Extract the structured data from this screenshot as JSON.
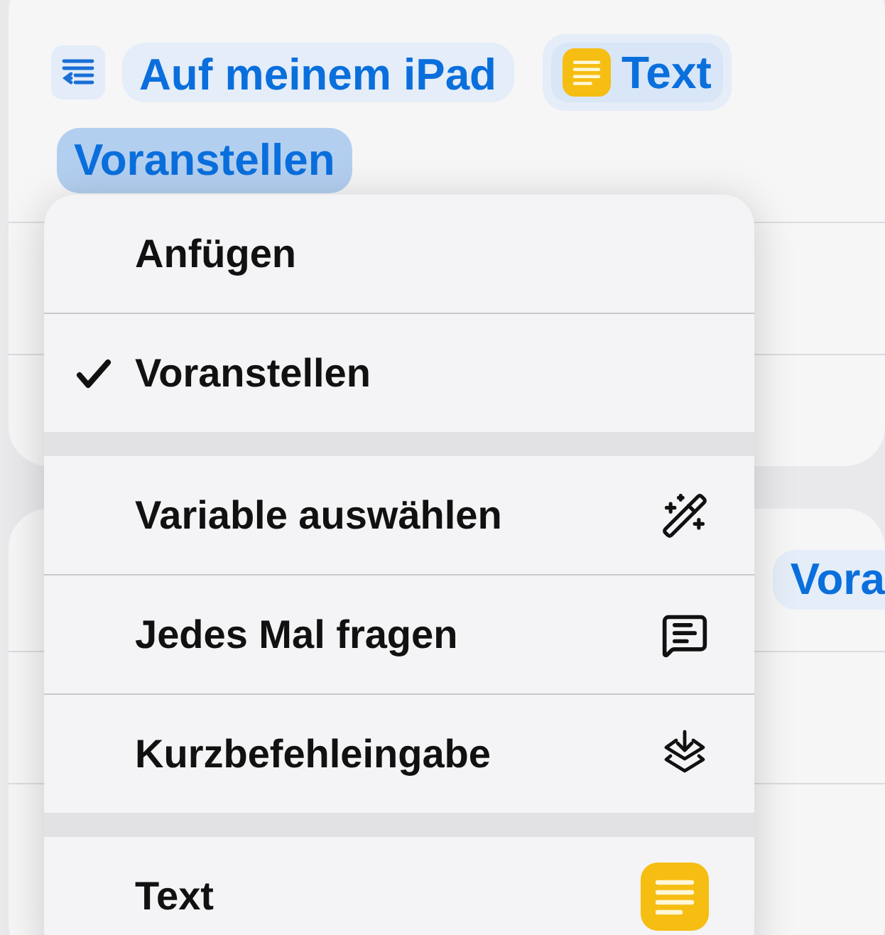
{
  "action": {
    "chips": [
      {
        "label": "Auf meinem iPad",
        "kind": "plain"
      },
      {
        "label": "Text",
        "kind": "text_variable"
      }
    ],
    "mode_chip": {
      "label": "Voranstellen",
      "selected": true
    }
  },
  "next_action": {
    "chip": "Vora"
  },
  "menu": {
    "sections": [
      [
        {
          "label": "Anfügen",
          "selected": false
        },
        {
          "label": "Voranstellen",
          "selected": true
        }
      ],
      [
        {
          "label": "Variable auswählen",
          "kind": "magic"
        },
        {
          "label": "Jedes Mal fragen",
          "kind": "ask"
        },
        {
          "label": "Kurzbefehleingabe",
          "kind": "input"
        }
      ],
      [
        {
          "label": "Text",
          "kind": "text"
        }
      ]
    ]
  }
}
